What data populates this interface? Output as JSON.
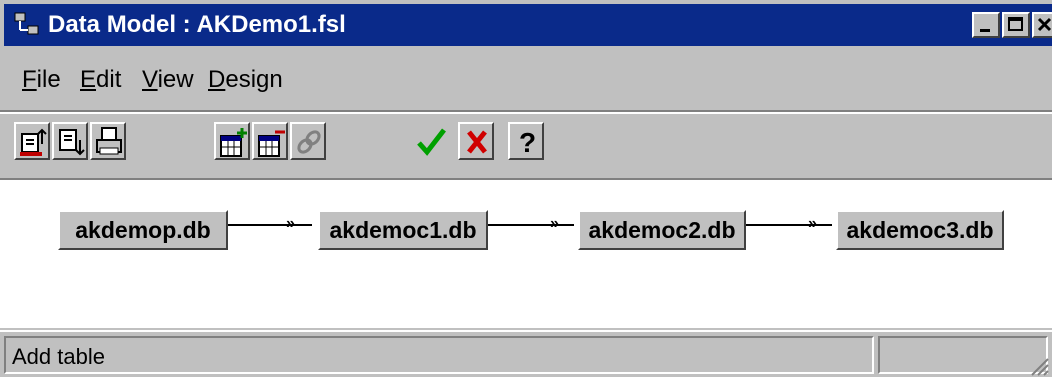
{
  "window": {
    "title": "Data Model : AKDemo1.fsl"
  },
  "menu": [
    {
      "label": "File",
      "ul": "F",
      "rest": "ile"
    },
    {
      "label": "Edit",
      "ul": "E",
      "rest": "dit"
    },
    {
      "label": "View",
      "ul": "V",
      "rest": "iew"
    },
    {
      "label": "Design",
      "ul": "D",
      "rest": "esign"
    }
  ],
  "toolbar": {
    "buttons": [
      {
        "name": "open-icon"
      },
      {
        "name": "save-icon"
      },
      {
        "name": "print-icon"
      },
      {
        "name": "add-table-icon"
      },
      {
        "name": "remove-table-icon"
      },
      {
        "name": "link-icon"
      },
      {
        "name": "ok-icon"
      },
      {
        "name": "cancel-icon"
      },
      {
        "name": "help-icon"
      }
    ],
    "help_glyph": "?"
  },
  "tables": [
    "akdemop.db",
    "akdemoc1.db",
    "akdemoc2.db",
    "akdemoc3.db"
  ],
  "link_glyph": "»",
  "status": {
    "message": "Add table"
  }
}
